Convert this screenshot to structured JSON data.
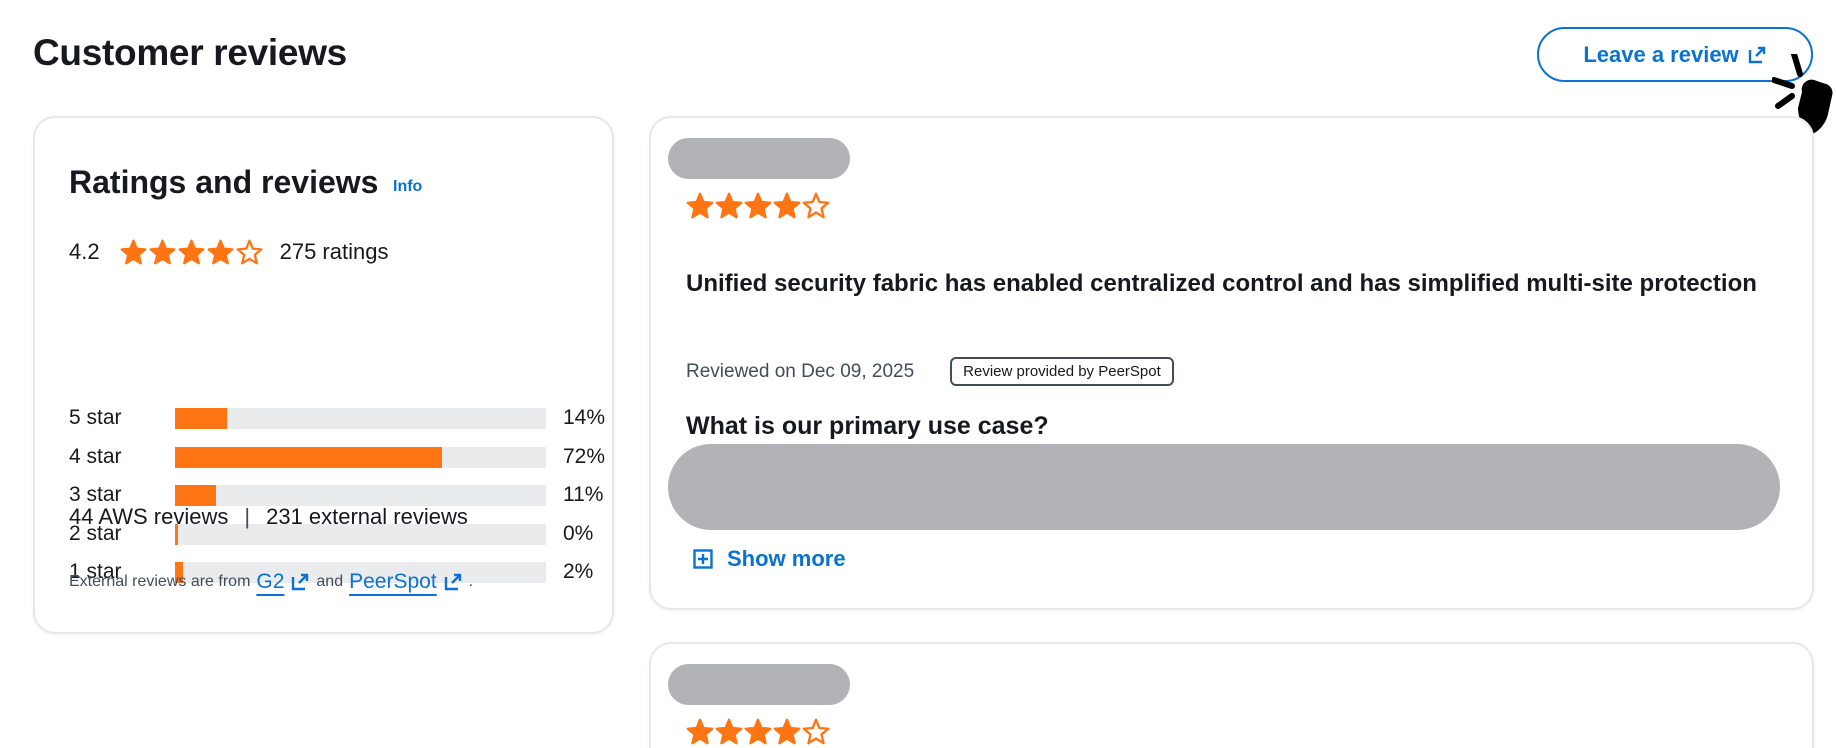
{
  "header": {
    "title": "Customer reviews",
    "leave_review_label": "Leave a review"
  },
  "ratings": {
    "title": "Ratings and reviews",
    "info_label": "Info",
    "average": "4.2",
    "average_value": 4.2,
    "ratings_count": "275 ratings",
    "distribution": [
      {
        "label": "5 star",
        "percent": 14,
        "percent_label": "14%"
      },
      {
        "label": "4 star",
        "percent": 72,
        "percent_label": "72%"
      },
      {
        "label": "3 star",
        "percent": 11,
        "percent_label": "11%"
      },
      {
        "label": "2 star",
        "percent": 0,
        "percent_label": "0%"
      },
      {
        "label": "1 star",
        "percent": 2,
        "percent_label": "2%"
      }
    ],
    "aws_reviews": "44 AWS reviews",
    "separator": "|",
    "external_reviews": "231 external reviews",
    "external_note_prefix": "External reviews are from",
    "external_note_and": "and",
    "external_note_suffix": ".",
    "external_sources": [
      "G2",
      "PeerSpot"
    ]
  },
  "reviews": [
    {
      "stars": 4,
      "title": "Unified security fabric has enabled centralized control and has simplified multi-site protection",
      "date": "Reviewed on Dec 09, 2025",
      "provider_badge": "Review provided by PeerSpot",
      "question": "What is our primary use case?",
      "show_more_label": "Show more"
    },
    {
      "stars": 4
    }
  ],
  "colors": {
    "accent_blue": "#0972d3",
    "star_orange": "#ff7513",
    "redacted_gray": "#b1b3b6"
  },
  "icons": {
    "external_link": "external-link-icon",
    "star": "star-icon",
    "show_more": "plus-square-icon",
    "cursor": "hand-pointer-icon"
  }
}
